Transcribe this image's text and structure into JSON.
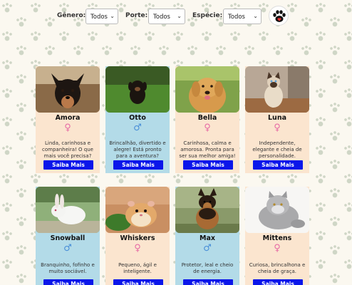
{
  "filters": {
    "genero_label": "Gênero:",
    "genero_value": "Todos",
    "porte_label": "Porte:",
    "porte_value": "Todos",
    "especie_label": "Espécie:",
    "especie_value": "Todos",
    "logo_icon": "paw-logo-icon"
  },
  "pets": [
    {
      "name": "Amora",
      "sex_symbol": "♀",
      "sex": "female",
      "desc": "Linda, carinhosa e companheira! O que mais você precisa?",
      "button": "Saiba Mais"
    },
    {
      "name": "Otto",
      "sex_symbol": "♂",
      "sex": "male",
      "desc": "Brincalhão, divertido e alegre! Está pronto para a aventura?",
      "button": "Saiba Mais"
    },
    {
      "name": "Bella",
      "sex_symbol": "♀",
      "sex": "female",
      "desc": "Carinhosa, calma e amorosa. Pronta para ser sua melhor amiga!",
      "button": "Saiba Mais"
    },
    {
      "name": "Luna",
      "sex_symbol": "♀",
      "sex": "female",
      "desc": "Independente, elegante e cheia de personalidade.",
      "button": "Saiba Mais"
    },
    {
      "name": "Snowball",
      "sex_symbol": "♂",
      "sex": "male",
      "desc": "Branquinho, fofinho e muito sociável.",
      "button": "Saiba Mais"
    },
    {
      "name": "Whiskers",
      "sex_symbol": "♀",
      "sex": "female",
      "desc": "Pequeno, ágil e inteligente.",
      "button": "Saiba Mais"
    },
    {
      "name": "Max",
      "sex_symbol": "♂",
      "sex": "male",
      "desc": "Protetor, leal e cheio de energia.",
      "button": "Saiba Mais"
    },
    {
      "name": "Mittens",
      "sex_symbol": "♀",
      "sex": "female",
      "desc": "Curiosa, brincalhona e cheia de graça.",
      "button": "Saiba Mais"
    }
  ],
  "colors": {
    "female_card": "#fbe5cf",
    "male_card": "#b3dbe8",
    "button": "#0b16ea",
    "female_symbol": "#e66aa4",
    "male_symbol": "#4a8fd8"
  }
}
